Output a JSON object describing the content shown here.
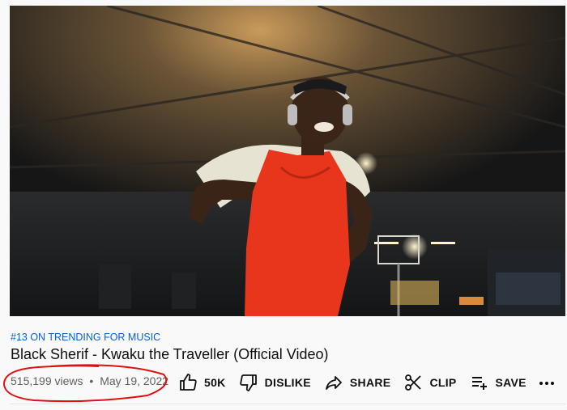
{
  "video": {
    "trending_label": "#13 ON TRENDING FOR MUSIC",
    "title": "Black Sherif - Kwaku the Traveller (Official Video)",
    "views": "515,199 views",
    "separator": "•",
    "date": "May 19, 2022"
  },
  "actions": {
    "like_count": "50K",
    "dislike_label": "DISLIKE",
    "share_label": "SHARE",
    "clip_label": "CLIP",
    "save_label": "SAVE"
  },
  "colors": {
    "trending_link": "#065fd4",
    "annotation_circle": "#e01010",
    "jersey": "#e8361c"
  }
}
